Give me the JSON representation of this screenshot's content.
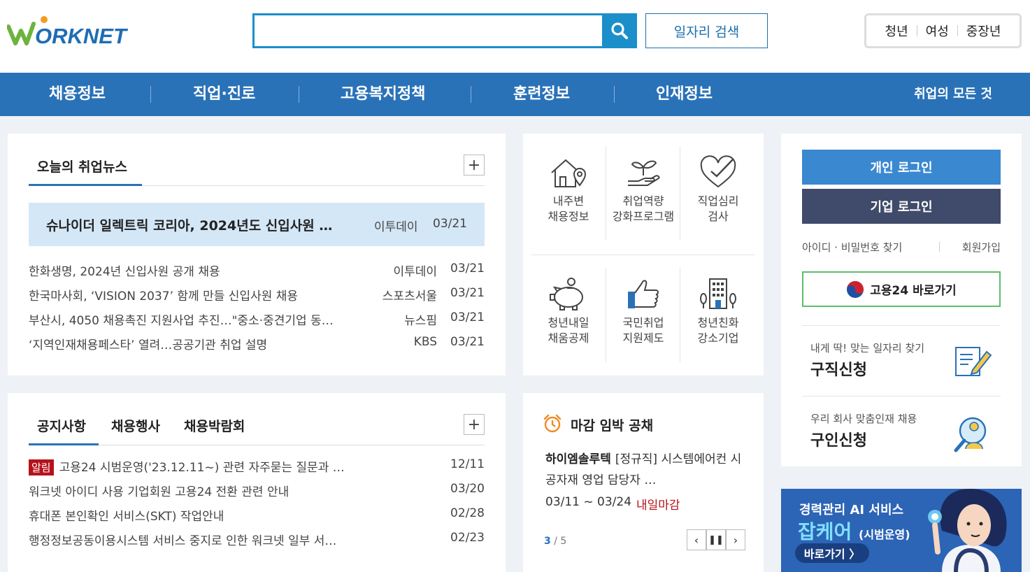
{
  "header": {
    "logo_text": "WORKNET",
    "search": {
      "placeholder": "",
      "value": ""
    },
    "job_search_label": "일자리 검색",
    "audience": [
      "청년",
      "여성",
      "중장년"
    ]
  },
  "gnb": {
    "items": [
      "채용정보",
      "직업·진로",
      "고용복지정책",
      "훈련정보",
      "인재정보"
    ],
    "right_link": "취업의 모든 것"
  },
  "news": {
    "tab": "오늘의 취업뉴스",
    "headline": {
      "title": "슈나이더 일렉트릭 코리아, 2024년도 신입사원 …",
      "source": "이투데이",
      "date": "03/21"
    },
    "items": [
      {
        "title": "한화생명, 2024년 신입사원 공개 채용",
        "source": "이투데이",
        "date": "03/21"
      },
      {
        "title": "한국마사회, ‘VISION 2037’ 함께 만들 신입사원 채용",
        "source": "스포츠서울",
        "date": "03/21"
      },
      {
        "title": "부산시, 4050 채용촉진 지원사업 추진…\"중소·중견기업 동…",
        "source": "뉴스핌",
        "date": "03/21"
      },
      {
        "title": "‘지역인재채용페스타’ 열려…공공기관 취업 설명",
        "source": "KBS",
        "date": "03/21"
      }
    ]
  },
  "quick_menu": [
    {
      "line1": "내주변",
      "line2": "채용정보",
      "icon": "house-pin-icon"
    },
    {
      "line1": "취업역량",
      "line2": "강화프로그램",
      "icon": "sprout-hand-icon"
    },
    {
      "line1": "직업심리",
      "line2": "검사",
      "icon": "heart-check-icon"
    },
    {
      "line1": "청년내일",
      "line2": "채움공제",
      "icon": "piggy-bank-icon"
    },
    {
      "line1": "국민취업",
      "line2": "지원제도",
      "icon": "thumbs-up-icon"
    },
    {
      "line1": "청년친화",
      "line2": "강소기업",
      "icon": "building-icon"
    }
  ],
  "login": {
    "personal": "개인 로그인",
    "company": "기업 로그인",
    "find": "아이디 · 비밀번호 찾기",
    "join": "회원가입",
    "goyong24": "고용24 바로가기",
    "services": [
      {
        "sub": "내게 딱! 맞는 일자리 찾기",
        "title": "구직신청",
        "icon": "resume-pen-icon"
      },
      {
        "sub": "우리 회사 맞춤인재 채용",
        "title": "구인신청",
        "icon": "person-search-icon"
      }
    ]
  },
  "notice": {
    "tabs": [
      "공지사항",
      "채용행사",
      "채용박람회"
    ],
    "badge": "알림",
    "items": [
      {
        "title": "고용24 시범운영('23.12.11~) 관련 자주묻는 질문과 …",
        "date": "12/11"
      },
      {
        "title": "워크넷 아이디 사용 기업회원 고용24 전환 관련 안내",
        "date": "03/20"
      },
      {
        "title": "휴대폰 본인확인 서비스(SKT) 작업안내",
        "date": "02/28"
      },
      {
        "title": "행정정보공동이용시스템 서비스 중지로 인한 워크넷 일부 서…",
        "date": "02/23"
      }
    ]
  },
  "deadline": {
    "title": "마감 임박 공채",
    "company": "하이엠솔루텍",
    "posting": "[정규직] 시스템에어컨 시공자재 영업 담당자 …",
    "period": "03/11 ~ 03/24",
    "due": "내일마감",
    "page_current": "3",
    "page_total": " / 5"
  },
  "banner": {
    "line1": "경력관리 AI 서비스",
    "line2": "잡케어",
    "line2_sub": "(시범운영)",
    "button": "바로가기 〉"
  },
  "colors": {
    "primary": "#2a72b8",
    "search": "#1b8fc9",
    "alert": "#b5121b",
    "company_login": "#404a6a"
  }
}
